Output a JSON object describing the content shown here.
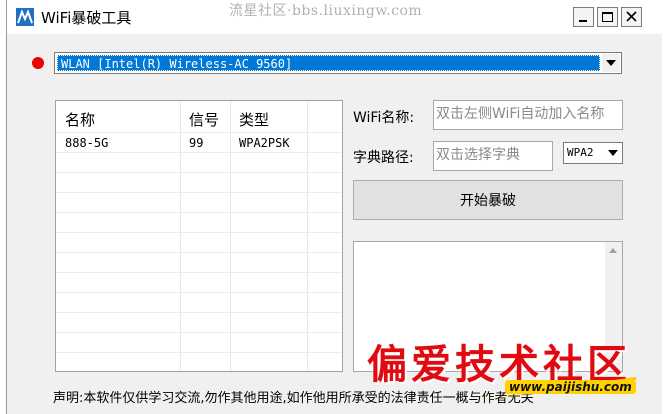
{
  "window": {
    "title": "WiFi暴破工具",
    "top_watermark": "流星社区·bbs.liuxingw.com",
    "controls": {
      "minimize": "_",
      "maximize": "□",
      "close": "×"
    }
  },
  "adapter": {
    "status_color": "#ee0000",
    "selected": "WLAN [Intel(R) Wireless-AC 9560]"
  },
  "list": {
    "columns": [
      "名称",
      "信号",
      "类型"
    ],
    "rows": [
      {
        "name": "888-5G",
        "signal": "99",
        "type": "WPA2PSK"
      }
    ]
  },
  "form": {
    "wifi_name_label": "WiFi名称:",
    "wifi_name_placeholder": "双击左侧WiFi自动加入名称",
    "dict_label": "字典路径:",
    "dict_placeholder": "双击选择字典",
    "auth_selected": "WPA2"
  },
  "actions": {
    "start_label": "开始暴破"
  },
  "log": {
    "content": ""
  },
  "footer": {
    "disclaimer": "声明:本软件仅供学习交流,勿作其他用途,如作他用所承受的法律责任一概与作者无关"
  },
  "watermark": {
    "brand": "偏爱技术社区",
    "url": "www.paijishu.com",
    "brand_color": "#e10a10",
    "url_bg": "#ffd200"
  }
}
